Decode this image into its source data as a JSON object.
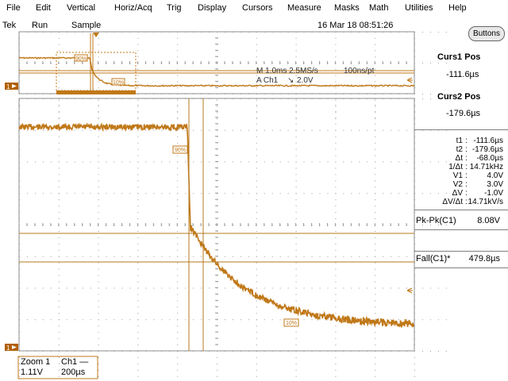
{
  "menu": [
    "File",
    "Edit",
    "Vertical",
    "Horiz/Acq",
    "Trig",
    "Display",
    "Cursors",
    "Measure",
    "Masks",
    "Math",
    "Utilities",
    "Help"
  ],
  "status": {
    "brand": "Tek",
    "run": "Run",
    "mode": "Sample",
    "datetime": "16 Mar 18 08:51:26"
  },
  "buttons_label": "Buttons",
  "curs1": {
    "title": "Curs1 Pos",
    "value": "-111.6µs"
  },
  "curs2": {
    "title": "Curs2 Pos",
    "value": "-179.6µs"
  },
  "cursor_readouts": [
    {
      "label": "t1",
      "value": "-111.6µs"
    },
    {
      "label": "t2",
      "value": "-179.6µs"
    },
    {
      "label": "Δt",
      "value": "-68.0µs"
    },
    {
      "label": "1/Δt",
      "value": "14.71kHz"
    },
    {
      "label": "V1",
      "value": "4.0V"
    },
    {
      "label": "V2",
      "value": "3.0V"
    },
    {
      "label": "ΔV",
      "value": "-1.0V"
    },
    {
      "label": "ΔV/Δt",
      "value": "14.71kV/s"
    }
  ],
  "measurements": [
    {
      "label": "Pk-Pk(C1)",
      "value": "8.08V"
    },
    {
      "label": "Fall(C1)*",
      "value": "479.8µs"
    }
  ],
  "overview": {
    "horiz": "M 1.0ms 2.5MS/s",
    "res": "100ns/pt",
    "trig_ch": "A  Ch1",
    "trig_level": "2.0V"
  },
  "ref_labels": {
    "high": "90%",
    "low": "10%"
  },
  "bottom": {
    "zoom": "Zoom 1",
    "factor": "1.11V",
    "ch": "Ch1 —",
    "timebase": "200µs"
  },
  "colors": {
    "trace": "#c07818",
    "grid": "#8c8c8c",
    "cursor": "#b4781e",
    "marker_bg": "#b06000"
  }
}
